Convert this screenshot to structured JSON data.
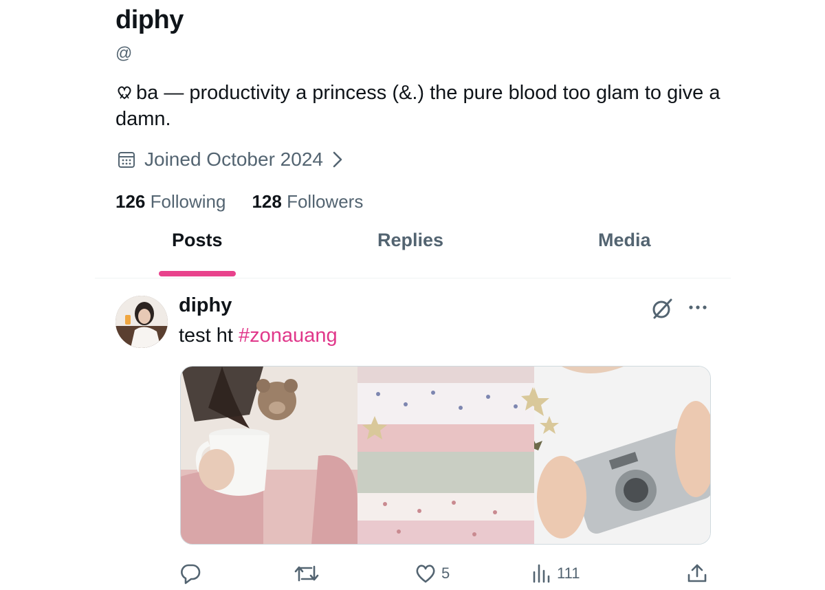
{
  "profile": {
    "display_name": "diphy",
    "handle": "@",
    "bio": "ba — productivity a princess (&.) the pure blood too glam to give a damn.",
    "bio_emoji": "heart-ribbon-icon",
    "joined": "Joined October 2024",
    "following_count": "126",
    "following_label": "Following",
    "followers_count": "128",
    "followers_label": "Followers"
  },
  "tabs": [
    {
      "label": "Posts",
      "active": true
    },
    {
      "label": "Replies",
      "active": false
    },
    {
      "label": "Media",
      "active": false
    }
  ],
  "post": {
    "author": "diphy",
    "text": "test ht ",
    "hashtag": "#zonauang",
    "media": [
      "photo-girl-with-mug-and-teddy-sweater",
      "photo-folded-floral-pink-clothes-with-stars",
      "photo-hands-holding-silver-camera"
    ],
    "actions": {
      "reply_count": "",
      "repost_count": "",
      "like_count": "5",
      "views_count": "111"
    }
  },
  "colors": {
    "accent": "#e8428c",
    "hashtag": "#e0378a",
    "secondary_text": "#536471",
    "primary_text": "#0f1419"
  }
}
